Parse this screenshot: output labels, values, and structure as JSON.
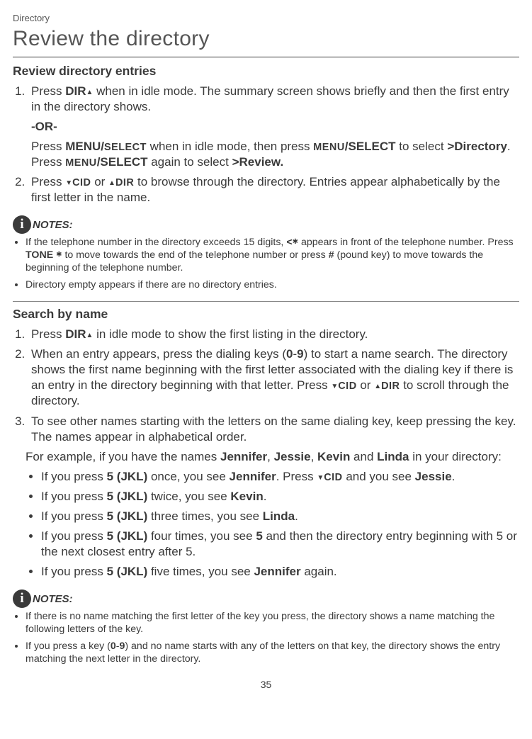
{
  "breadcrumb": "Directory",
  "page_title": "Review the directory",
  "section1": {
    "heading": "Review directory entries",
    "steps": {
      "s1_lead": "Press ",
      "s1_key": "DIR",
      "s1_rest": " when in idle mode. The summary screen shows briefly and then the first entry in the directory shows.",
      "or": "-OR-",
      "s1b_a": "Press ",
      "s1b_key1": "MENU/",
      "s1b_key1b": "SELECT",
      "s1b_b": " when in idle mode, then press ",
      "s1b_key2a": "MENU",
      "s1b_key2b": "/SELECT",
      "s1b_c": " to select ",
      "s1b_dir": ">Directory",
      "s1b_d": ". Press ",
      "s1b_key3a": "MENU",
      "s1b_key3b": "/SELECT",
      "s1b_e": " again to select ",
      "s1b_rev": ">Review.",
      "s2_a": "Press ",
      "s2_cid": "CID",
      "s2_b": " or ",
      "s2_dir": "DIR",
      "s2_c": " to browse through the directory. Entries appear alphabetically by the first letter in the name."
    }
  },
  "notes_label": "NOTES:",
  "notes1": {
    "n1_a": "If the telephone number in the directory exceeds 15 digits, ",
    "n1_sym": "<",
    "n1_b": " appears in front of the telephone number. Press ",
    "n1_tone": "TONE ",
    "n1_c": " to move towards the end of the telephone number or press ",
    "n1_pound": "#",
    "n1_d": " (pound key) to move towards the beginning of the telephone number.",
    "n2": "Directory empty appears if there are no directory entries."
  },
  "section2": {
    "heading": "Search by name",
    "s1_a": "Press ",
    "s1_key": "DIR",
    "s1_b": " in idle mode to show the first listing in the directory.",
    "s2_a": "When an entry appears, press the dialing keys (",
    "s2_range": "0",
    "s2_dash": "-",
    "s2_range2": "9",
    "s2_b": ") to start a name search. The directory shows the first name beginning with the first letter associated with the dialing key if there is an entry in the directory beginning with that letter. Press ",
    "s2_cid": "CID",
    "s2_c": " or ",
    "s2_dir": "DIR",
    "s2_d": " to scroll through the directory.",
    "s3": "To see other names starting with the letters on the same dialing key, keep pressing the key. The names appear in alphabetical order."
  },
  "example_intro_a": "For example, if you have the names ",
  "example_names": {
    "n1": "Jennifer",
    "n2": "Jessie",
    "n3": "Kevin",
    "n4": "Linda"
  },
  "example_intro_b": " in your directory:",
  "examples": {
    "e1_a": "If you press ",
    "e1_key": "5 (JKL)",
    "e1_b": " once, you see ",
    "e1_name": "Jennifer",
    "e1_c": ". Press ",
    "e1_cid": "CID",
    "e1_d": " and you see ",
    "e1_name2": "Jessie",
    "e1_e": ".",
    "e2_a": "If you press ",
    "e2_key": "5 (JKL)",
    "e2_b": " twice, you see ",
    "e2_name": "Kevin",
    "e2_c": ".",
    "e3_a": "If you press ",
    "e3_key": "5 (JKL)",
    "e3_b": " three times, you see ",
    "e3_name": "Linda",
    "e3_c": ".",
    "e4_a": "If you press ",
    "e4_key": "5 (JKL)",
    "e4_b": " four times, you see ",
    "e4_five": "5",
    "e4_c": " and then the directory entry beginning with 5 or the next closest entry after 5.",
    "e5_a": "If you press ",
    "e5_key": "5 (JKL)",
    "e5_b": " five times, you see ",
    "e5_name": "Jennifer",
    "e5_c": " again."
  },
  "notes2": {
    "n1": "If there is no name matching the first letter of the key you press, the directory shows a name matching the following letters of the key.",
    "n2_a": "If you press a key (",
    "n2_r1": "0",
    "n2_d": "-",
    "n2_r2": "9",
    "n2_b": ") and no name starts with any of the letters on that key, the directory shows the entry matching the next letter in the directory."
  },
  "page_number": "35"
}
